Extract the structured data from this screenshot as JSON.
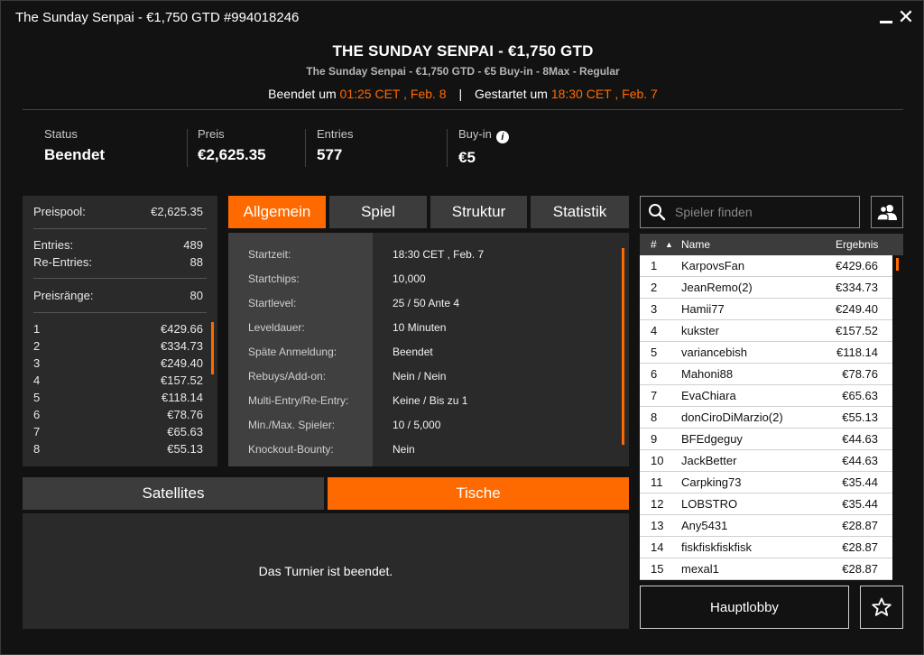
{
  "window": {
    "title": "The Sunday Senpai - €1,750 GTD #994018246",
    "minimize_icon": "minimize-icon",
    "close_icon": "close-icon",
    "close_glyph": "✕"
  },
  "header": {
    "title": "THE SUNDAY SENPAI - €1,750 GTD",
    "subtitle": "The Sunday Senpai - €1,750 GTD - €5 Buy-in - 8Max - Regular",
    "ended_label": "Beendet um",
    "ended_time": "01:25 CET , Feb. 8",
    "separator": "|",
    "started_label": "Gestartet um",
    "started_time": "18:30 CET , Feb. 7",
    "accent_color": "#ff6a00"
  },
  "stats": [
    {
      "label": "Status",
      "value": "Beendet"
    },
    {
      "label": "Preis",
      "value": "€2,625.35"
    },
    {
      "label": "Entries",
      "value": "577"
    },
    {
      "label": "Buy-in",
      "value": "€5",
      "icon": "info-icon",
      "icon_glyph": "i"
    }
  ],
  "prizepool": {
    "pool_label": "Preispool:",
    "pool_value": "€2,625.35",
    "entries_label": "Entries:",
    "entries_value": "489",
    "reentries_label": "Re-Entries:",
    "reentries_value": "88",
    "ranks_label": "Preisränge:",
    "ranks_value": "80",
    "payouts": [
      {
        "rank": "1",
        "prize": "€429.66"
      },
      {
        "rank": "2",
        "prize": "€334.73"
      },
      {
        "rank": "3",
        "prize": "€249.40"
      },
      {
        "rank": "4",
        "prize": "€157.52"
      },
      {
        "rank": "5",
        "prize": "€118.14"
      },
      {
        "rank": "6",
        "prize": "€78.76"
      },
      {
        "rank": "7",
        "prize": "€65.63"
      },
      {
        "rank": "8",
        "prize": "€55.13"
      }
    ]
  },
  "tabs": [
    {
      "label": "Allgemein",
      "active": true
    },
    {
      "label": "Spiel",
      "active": false
    },
    {
      "label": "Struktur",
      "active": false
    },
    {
      "label": "Statistik",
      "active": false
    }
  ],
  "general_info": [
    {
      "label": "Startzeit:",
      "value": "18:30 CET , Feb. 7"
    },
    {
      "label": "Startchips:",
      "value": "10,000"
    },
    {
      "label": "Startlevel:",
      "value": "25 / 50 Ante 4"
    },
    {
      "label": "Leveldauer:",
      "value": "10 Minuten"
    },
    {
      "label": "Späte Anmeldung:",
      "value": "Beendet"
    },
    {
      "label": "Rebuys/Add-on:",
      "value": "Nein / Nein"
    },
    {
      "label": "Multi-Entry/Re-Entry:",
      "value": "Keine / Bis zu 1"
    },
    {
      "label": "Min./Max. Spieler:",
      "value": "10 / 5,000"
    },
    {
      "label": "Knockout-Bounty:",
      "value": "Nein"
    }
  ],
  "bottom_tabs": {
    "satellites": "Satellites",
    "tables": "Tische",
    "ended_message": "Das Turnier ist beendet."
  },
  "search": {
    "placeholder": "Spieler finden",
    "icon": "search-icon",
    "side_button_icon": "players-icon"
  },
  "players": {
    "header": {
      "rank": "#",
      "sort": "▲",
      "name": "Name",
      "result": "Ergebnis"
    },
    "rows": [
      {
        "rank": "1",
        "name": "KarpovsFan",
        "result": "€429.66"
      },
      {
        "rank": "2",
        "name": "JeanRemo(2)",
        "result": "€334.73"
      },
      {
        "rank": "3",
        "name": "Hamii77",
        "result": "€249.40"
      },
      {
        "rank": "4",
        "name": "kukster",
        "result": "€157.52"
      },
      {
        "rank": "5",
        "name": "variancebish",
        "result": "€118.14"
      },
      {
        "rank": "6",
        "name": "Mahoni88",
        "result": "€78.76"
      },
      {
        "rank": "7",
        "name": "EvaChiara",
        "result": "€65.63"
      },
      {
        "rank": "8",
        "name": "donCiroDiMarzio(2)",
        "result": "€55.13"
      },
      {
        "rank": "9",
        "name": "BFEdgeguy",
        "result": "€44.63"
      },
      {
        "rank": "10",
        "name": "JackBetter",
        "result": "€44.63"
      },
      {
        "rank": "11",
        "name": "Carpking73",
        "result": "€35.44"
      },
      {
        "rank": "12",
        "name": "LOBSTRO",
        "result": "€35.44"
      },
      {
        "rank": "13",
        "name": "Any5431",
        "result": "€28.87"
      },
      {
        "rank": "14",
        "name": "fiskfiskfiskfisk",
        "result": "€28.87"
      },
      {
        "rank": "15",
        "name": "mexal1",
        "result": "€28.87"
      }
    ]
  },
  "footer": {
    "lobby_button": "Hauptlobby",
    "favorite_icon": "star-icon"
  }
}
